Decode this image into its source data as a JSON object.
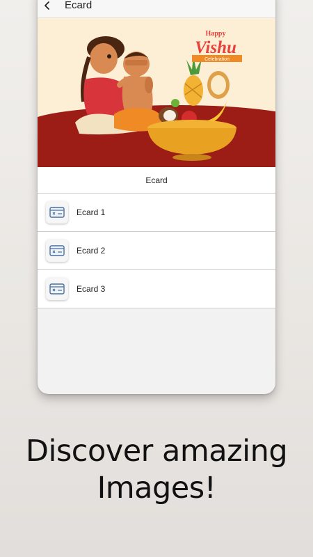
{
  "app_bar": {
    "title": "Ecard",
    "back_icon": "chevron-left-icon"
  },
  "banner": {
    "greeting_top": "Happy",
    "greeting_main": "Vishu",
    "greeting_sub": "Celebration",
    "colors": {
      "background": "#fdeed6",
      "ground": "#9c1c16",
      "title_red": "#e8413a",
      "ribbon_orange": "#f08a24",
      "bowl_gold": "#f2b233"
    }
  },
  "section": {
    "header": "Ecard"
  },
  "list": {
    "item_icon": "ecard-icon",
    "items": [
      {
        "label": "Ecard 1"
      },
      {
        "label": "Ecard 2"
      },
      {
        "label": "Ecard 3"
      }
    ]
  },
  "tagline": {
    "line1": "Discover amazing",
    "line2": "Images!"
  }
}
